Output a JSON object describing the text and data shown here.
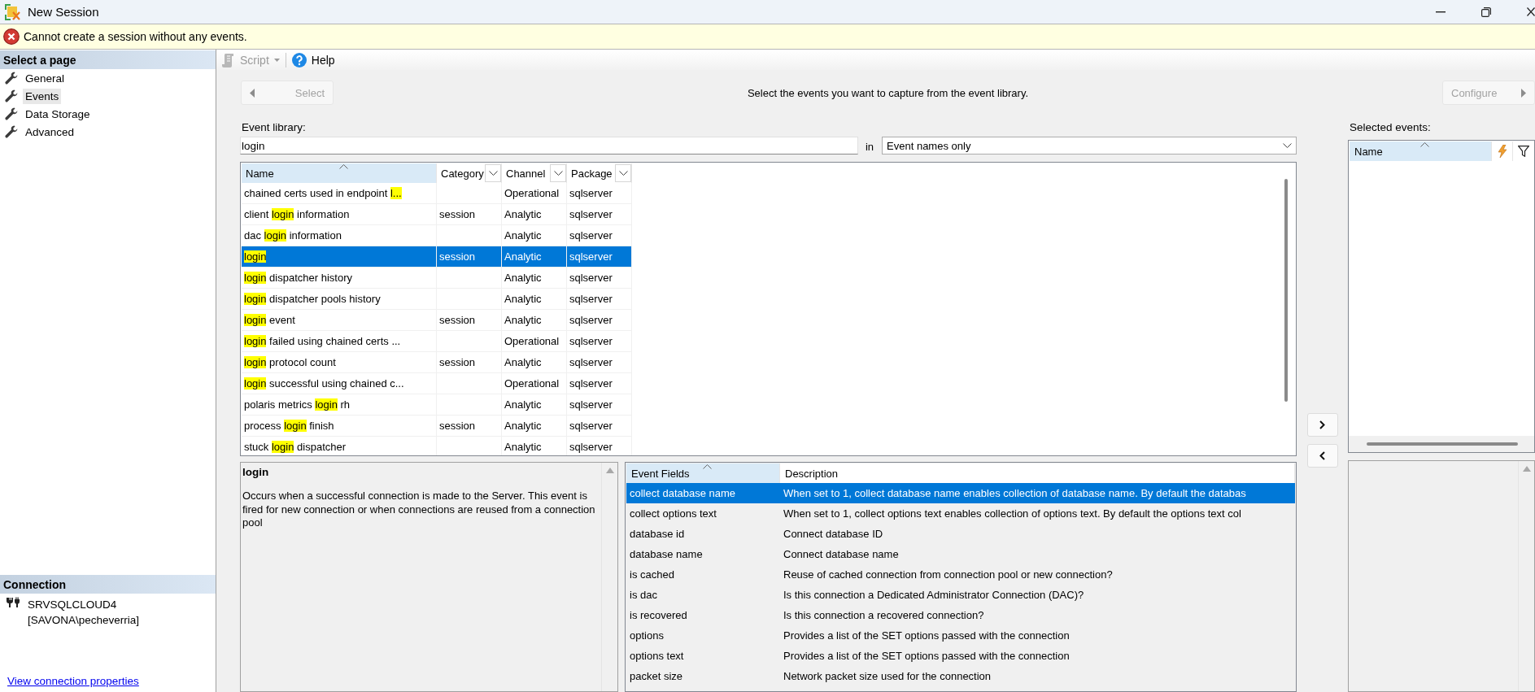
{
  "window": {
    "title": "New Session"
  },
  "error_bar": {
    "message": "Cannot create a session without any events."
  },
  "sidebar": {
    "heading": "Select a page",
    "items": [
      {
        "label": "General",
        "selected": false
      },
      {
        "label": "Events",
        "selected": true
      },
      {
        "label": "Data Storage",
        "selected": false
      },
      {
        "label": "Advanced",
        "selected": false
      }
    ],
    "connection": {
      "heading": "Connection",
      "server": "SRVSQLCLOUD4",
      "user": "[SAVONA\\pecheverria]",
      "link": "View connection properties"
    }
  },
  "toolbar": {
    "items": [
      {
        "kind": "script",
        "label": "Script",
        "disabled": true
      },
      {
        "kind": "help",
        "label": "Help",
        "disabled": false
      }
    ]
  },
  "wizard_nav": {
    "back": {
      "label": "Select",
      "disabled": true
    },
    "instruction": "Select the events you want to capture from the event library.",
    "next": {
      "label": "Configure",
      "disabled": true
    }
  },
  "event_library": {
    "label": "Event library:",
    "search": {
      "value": "login"
    },
    "scope_label": "in",
    "scope": {
      "value": "Event names only"
    },
    "table": {
      "columns": [
        {
          "label": "Name",
          "sorted": true,
          "filter": false
        },
        {
          "label": "Category",
          "sorted": false,
          "filter": true
        },
        {
          "label": "Channel",
          "sorted": false,
          "filter": true
        },
        {
          "label": "Package",
          "sorted": false,
          "filter": true
        }
      ],
      "rows": [
        {
          "name": [
            {
              "text": "chained certs used in endpoint ",
              "highlighted": false
            },
            {
              "text": "l...",
              "highlighted": true
            }
          ],
          "channel": "Operational",
          "package": "sqlserver",
          "selected": false
        },
        {
          "name": [
            {
              "text": "client ",
              "highlighted": false
            },
            {
              "text": "login",
              "highlighted": true
            },
            {
              "text": " information",
              "highlighted": false
            }
          ],
          "category": "session",
          "channel": "Analytic",
          "package": "sqlserver",
          "selected": false
        },
        {
          "name": [
            {
              "text": "dac ",
              "highlighted": false
            },
            {
              "text": "login",
              "highlighted": true
            },
            {
              "text": " information",
              "highlighted": false
            }
          ],
          "channel": "Analytic",
          "package": "sqlserver",
          "selected": false
        },
        {
          "name": [
            {
              "text": "login",
              "highlighted": true
            }
          ],
          "category": "session",
          "channel": "Analytic",
          "package": "sqlserver",
          "selected": true
        },
        {
          "name": [
            {
              "text": "login",
              "highlighted": true
            },
            {
              "text": " dispatcher history",
              "highlighted": false
            }
          ],
          "channel": "Analytic",
          "package": "sqlserver",
          "selected": false
        },
        {
          "name": [
            {
              "text": "login",
              "highlighted": true
            },
            {
              "text": " dispatcher pools history",
              "highlighted": false
            }
          ],
          "channel": "Analytic",
          "package": "sqlserver",
          "selected": false
        },
        {
          "name": [
            {
              "text": "login",
              "highlighted": true
            },
            {
              "text": " event",
              "highlighted": false
            }
          ],
          "category": "session",
          "channel": "Analytic",
          "package": "sqlserver",
          "selected": false
        },
        {
          "name": [
            {
              "text": "login",
              "highlighted": true
            },
            {
              "text": " failed using chained certs ...",
              "highlighted": false
            }
          ],
          "channel": "Operational",
          "package": "sqlserver",
          "selected": false
        },
        {
          "name": [
            {
              "text": "login",
              "highlighted": true
            },
            {
              "text": " protocol count",
              "highlighted": false
            }
          ],
          "category": "session",
          "channel": "Analytic",
          "package": "sqlserver",
          "selected": false
        },
        {
          "name": [
            {
              "text": "login",
              "highlighted": true
            },
            {
              "text": " successful using chained c...",
              "highlighted": false
            }
          ],
          "channel": "Operational",
          "package": "sqlserver",
          "selected": false
        },
        {
          "name": [
            {
              "text": "polaris metrics ",
              "highlighted": false
            },
            {
              "text": "login",
              "highlighted": true
            },
            {
              "text": " rh",
              "highlighted": false
            }
          ],
          "channel": "Analytic",
          "package": "sqlserver",
          "selected": false
        },
        {
          "name": [
            {
              "text": "process ",
              "highlighted": false
            },
            {
              "text": "login",
              "highlighted": true
            },
            {
              "text": " finish",
              "highlighted": false
            }
          ],
          "category": "session",
          "channel": "Analytic",
          "package": "sqlserver",
          "selected": false
        },
        {
          "name": [
            {
              "text": "stuck ",
              "highlighted": false
            },
            {
              "text": "login",
              "highlighted": true
            },
            {
              "text": " dispatcher",
              "highlighted": false
            }
          ],
          "channel": "Analytic",
          "package": "sqlserver",
          "selected": false
        }
      ]
    }
  },
  "selected_events": {
    "label": "Selected events:",
    "columns": [
      {
        "label": "Name",
        "sorted": true
      }
    ]
  },
  "event_details": {
    "title": "login",
    "description": "Occurs when a successful connection is made to the Server. This event is fired for new connection or when connections are reused from a connection pool"
  },
  "event_fields": {
    "columns": [
      {
        "label": "Event Fields",
        "sorted": true
      },
      {
        "label": "Description",
        "sorted": false
      }
    ],
    "rows": [
      {
        "field": "collect database name",
        "description": "When set to 1, collect database name enables collection of database name. By default the databas",
        "selected": true
      },
      {
        "field": "collect options text",
        "description": "When set to 1, collect options text enables collection of options text. By default the options text col",
        "selected": false
      },
      {
        "field": "database id",
        "description": "Connect database ID",
        "selected": false
      },
      {
        "field": "database name",
        "description": "Connect database name",
        "selected": false
      },
      {
        "field": "is cached",
        "description": "Reuse of cached connection from connection pool or new connection?",
        "selected": false
      },
      {
        "field": "is dac",
        "description": "Is this connection a Dedicated Administrator Connection (DAC)?",
        "selected": false
      },
      {
        "field": "is recovered",
        "description": "Is this connection a recovered connection?",
        "selected": false
      },
      {
        "field": "options",
        "description": "Provides a list of the SET options passed with the connection",
        "selected": false
      },
      {
        "field": "options text",
        "description": "Provides a list of the SET options passed with the connection",
        "selected": false
      },
      {
        "field": "packet size",
        "description": "Network packet size used for the connection",
        "selected": false
      }
    ]
  }
}
